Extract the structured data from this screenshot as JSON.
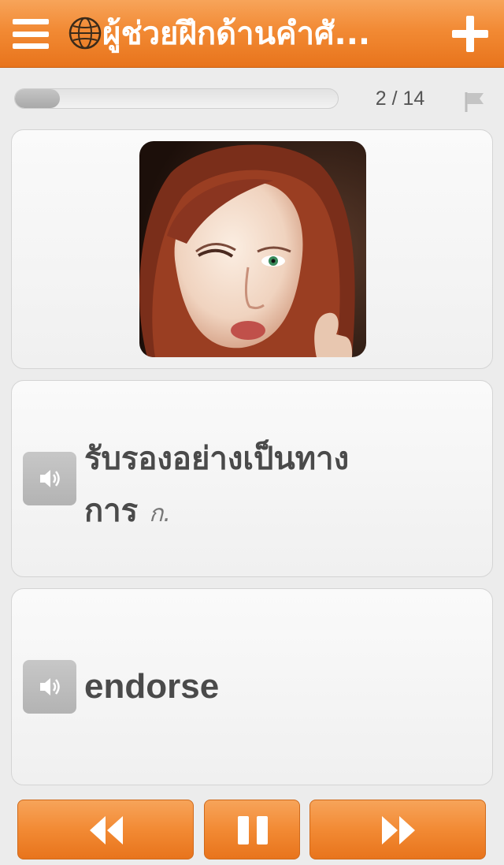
{
  "header": {
    "title": "ผู้ช่วยฝึกด้านคำศั...",
    "menu_icon": "hamburger-menu-icon",
    "globe_icon": "globe-icon",
    "add_icon": "plus-icon"
  },
  "progress": {
    "current": 2,
    "total": 14,
    "counter_text": "2 / 14",
    "fraction": 0.14,
    "flag_icon": "flag-icon"
  },
  "card": {
    "image_alt": "photo of woman winking",
    "thai_word": "รับรองอย่างเป็นทางการ",
    "part_of_speech": "ก.",
    "english_word": "endorse",
    "speaker_icon": "speaker-icon"
  },
  "controls": {
    "prev_icon": "rewind-icon",
    "pause_icon": "pause-icon",
    "next_icon": "fast-forward-icon"
  },
  "colors": {
    "accent": "#f28a34",
    "background": "#ececec",
    "text": "#4a4a4a"
  }
}
